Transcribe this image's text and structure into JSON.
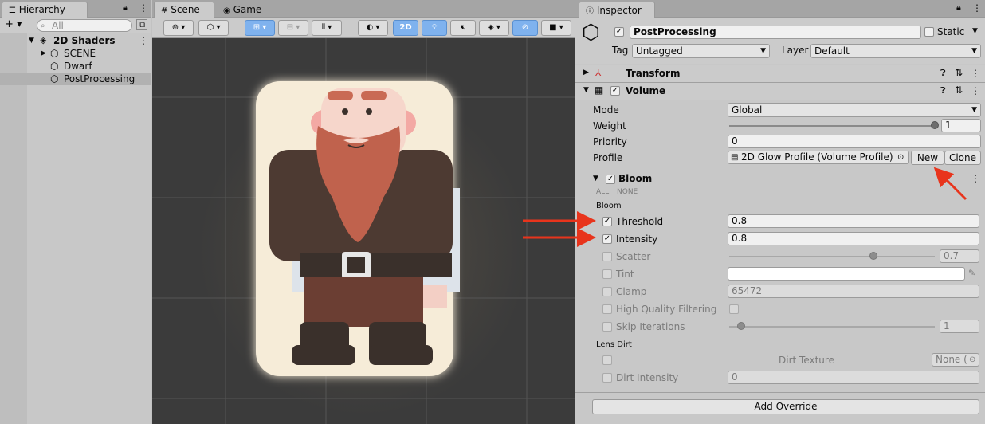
{
  "hierarchy": {
    "tab_label": "Hierarchy",
    "add_label": "+ ▾",
    "search_placeholder": "All",
    "root": "2D Shaders",
    "items": [
      {
        "label": "SCENE"
      },
      {
        "label": "Dwarf"
      },
      {
        "label": "PostProcessing"
      }
    ]
  },
  "scene": {
    "tabs": [
      {
        "label": "Scene"
      },
      {
        "label": "Game"
      }
    ],
    "toolbar": {
      "mode_2d": "2D"
    }
  },
  "inspector": {
    "tab_label": "Inspector",
    "object_name": "PostProcessing",
    "static_label": "Static",
    "tag_label": "Tag",
    "tag_value": "Untagged",
    "layer_label": "Layer",
    "layer_value": "Default",
    "components": {
      "transform": "Transform",
      "volume": "Volume"
    },
    "volume": {
      "mode_label": "Mode",
      "mode_value": "Global",
      "weight_label": "Weight",
      "weight_value": "1",
      "weight_fraction": 1.0,
      "priority_label": "Priority",
      "priority_value": "0",
      "profile_label": "Profile",
      "profile_value": "2D Glow Profile (Volume Profile)",
      "new_label": "New",
      "clone_label": "Clone"
    },
    "bloom": {
      "title": "Bloom",
      "all_label": "ALL",
      "none_label": "NONE",
      "section_bloom": "Bloom",
      "threshold_label": "Threshold",
      "threshold_value": "0.8",
      "intensity_label": "Intensity",
      "intensity_value": "0.8",
      "scatter_label": "Scatter",
      "scatter_value": "0.7",
      "scatter_fraction": 0.7,
      "tint_label": "Tint",
      "clamp_label": "Clamp",
      "clamp_value": "65472",
      "hq_label": "High Quality Filtering",
      "skip_label": "Skip Iterations",
      "skip_value": "1",
      "skip_fraction": 0.06,
      "lens_dirt": "Lens Dirt",
      "dirt_texture_label": "Dirt Texture",
      "dirt_texture_value": "None (",
      "dirt_intensity_label": "Dirt Intensity",
      "dirt_intensity_value": "0"
    },
    "add_override": "Add Override"
  },
  "colors": {
    "accent_blue": "#7fb2ee",
    "annotation_red": "#e8341c",
    "scene_bg": "#3b3b3b"
  }
}
